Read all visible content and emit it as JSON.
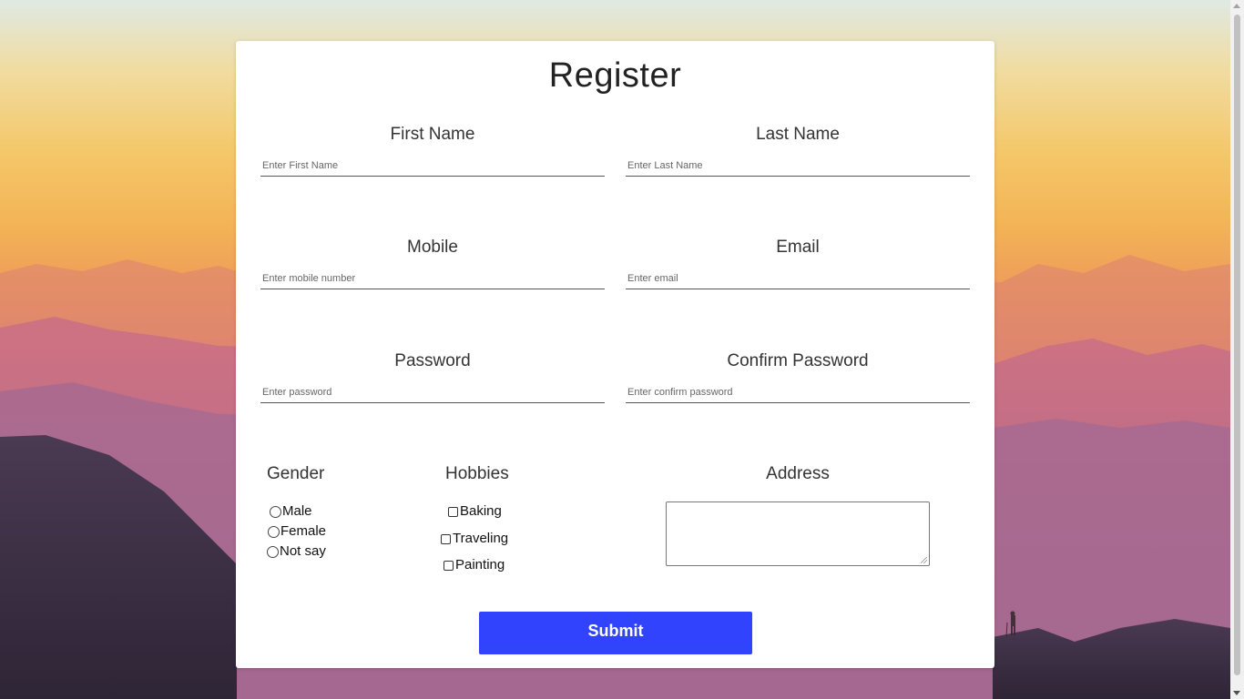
{
  "form": {
    "title": "Register",
    "first_name": {
      "label": "First Name",
      "placeholder": "Enter First Name",
      "value": ""
    },
    "last_name": {
      "label": "Last Name",
      "placeholder": "Enter Last Name",
      "value": ""
    },
    "mobile": {
      "label": "Mobile",
      "placeholder": "Enter mobile number",
      "value": ""
    },
    "email": {
      "label": "Email",
      "placeholder": "Enter email",
      "value": ""
    },
    "password": {
      "label": "Password",
      "placeholder": "Enter password",
      "value": ""
    },
    "confirm_password": {
      "label": "Confirm Password",
      "placeholder": "Enter confirm password",
      "value": ""
    },
    "gender": {
      "label": "Gender",
      "options": [
        "Male",
        "Female",
        "Not say"
      ],
      "selected": null
    },
    "hobbies": {
      "label": "Hobbies",
      "options": [
        "Baking",
        "Traveling",
        "Painting"
      ],
      "checked": []
    },
    "address": {
      "label": "Address",
      "value": ""
    },
    "submit_label": "Submit"
  },
  "colors": {
    "submit_button": "#3243fd",
    "card_background": "#ffffff"
  },
  "icons": {
    "radio": "radio-circle-icon",
    "checkbox": "checkbox-square-icon",
    "resize": "resize-grip-icon"
  }
}
